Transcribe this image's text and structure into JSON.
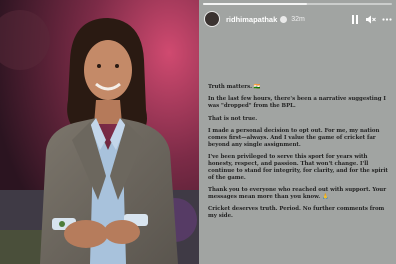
{
  "story": {
    "username": "ridhimapathak",
    "time": "32m",
    "progress": 0.55,
    "lines": [
      "Truth matters. 🇮🇳",
      "In the last few hours, there's been a narrative suggesting I was \"dropped\" from the BPL.",
      "That is not true.",
      "I made a personal decision to opt out. For me, my nation comes first—always. And I value the game of cricket far beyond any single assignment.",
      "I've been privileged to serve this sport for years with honesty, respect, and passion. That won't change. I'll continue to stand for integrity, for clarity, and for the spirit of the game.",
      "Thank you to everyone who reached out with support. Your messages mean more than you know. 🙏",
      "Cricket deserves truth. Period. No further comments from my side."
    ]
  },
  "icons": {
    "verified": "verified-badge-icon",
    "pause": "pause-icon",
    "mute": "speaker-muted-icon",
    "more": "more-options-icon"
  },
  "colors": {
    "story_background": "#a1a4a2",
    "text": "#232323"
  }
}
